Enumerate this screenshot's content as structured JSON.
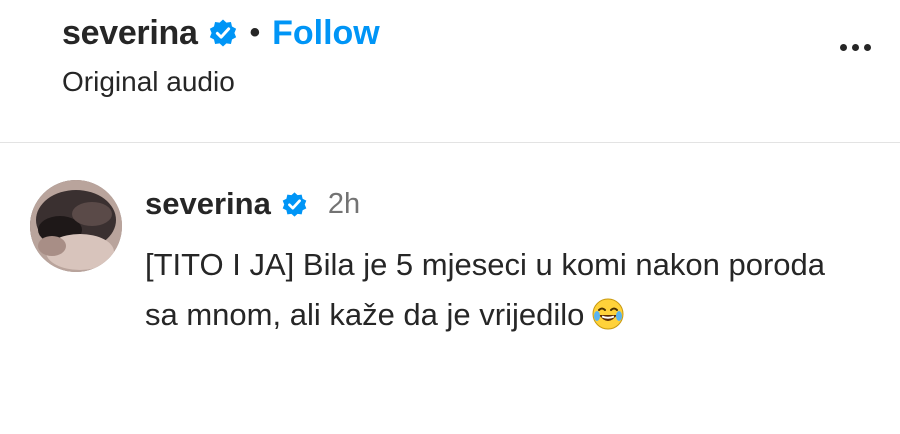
{
  "header": {
    "username": "severina",
    "separator": "•",
    "follow_label": "Follow",
    "subtitle": "Original audio"
  },
  "comment": {
    "username": "severina",
    "time": "2h",
    "text": "[TITO I JA] Bila je 5 mjeseci u komi nakon poroda sa mnom, ali kaže da je vrijedilo",
    "emoji": "face-with-tears-of-joy"
  },
  "colors": {
    "accent": "#0095f6",
    "verified": "#0095f6",
    "text": "#262626",
    "muted": "#737373"
  }
}
